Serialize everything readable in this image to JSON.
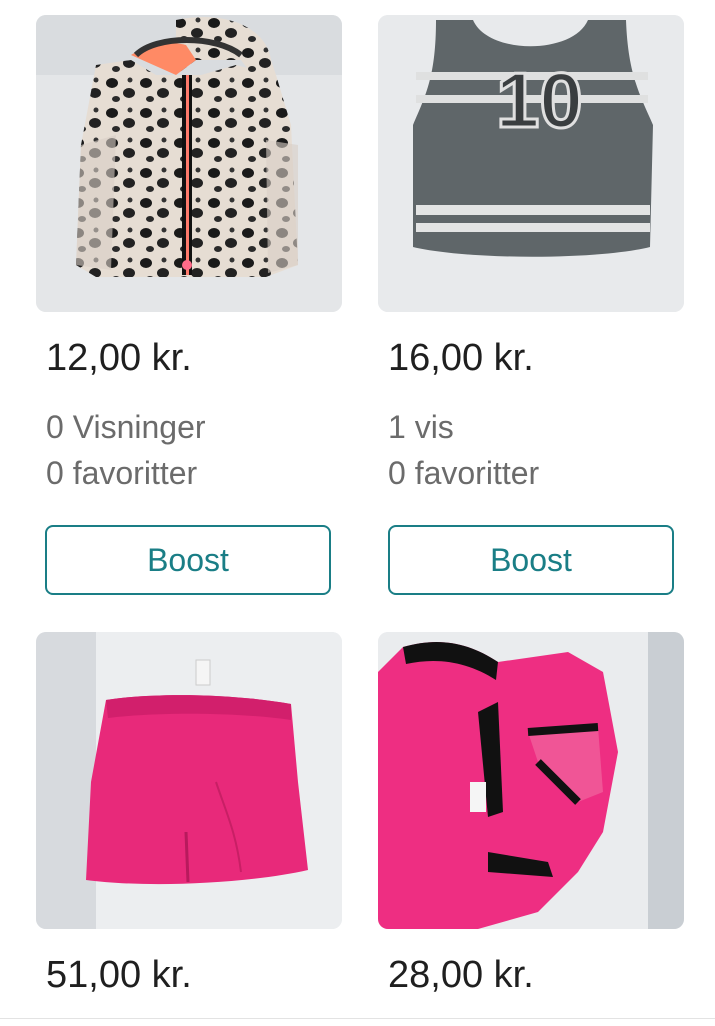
{
  "items": [
    {
      "price": "12,00 kr.",
      "views": "0 Visninger",
      "favorites": "0 favoritter",
      "boost_label": "Boost",
      "image": "leopard-print-vest-photo"
    },
    {
      "price": "16,00 kr.",
      "views": "1 vis",
      "favorites": "0 favoritter",
      "boost_label": "Boost",
      "image": "grey-number-10-tank-top-photo"
    },
    {
      "price": "51,00 kr.",
      "image": "pink-skirt-photo"
    },
    {
      "price": "28,00 kr.",
      "image": "pink-black-top-photo"
    }
  ],
  "colors": {
    "accent": "#1a7e86",
    "price_text": "#1f1f1f",
    "meta_text": "#6b6b6b"
  }
}
